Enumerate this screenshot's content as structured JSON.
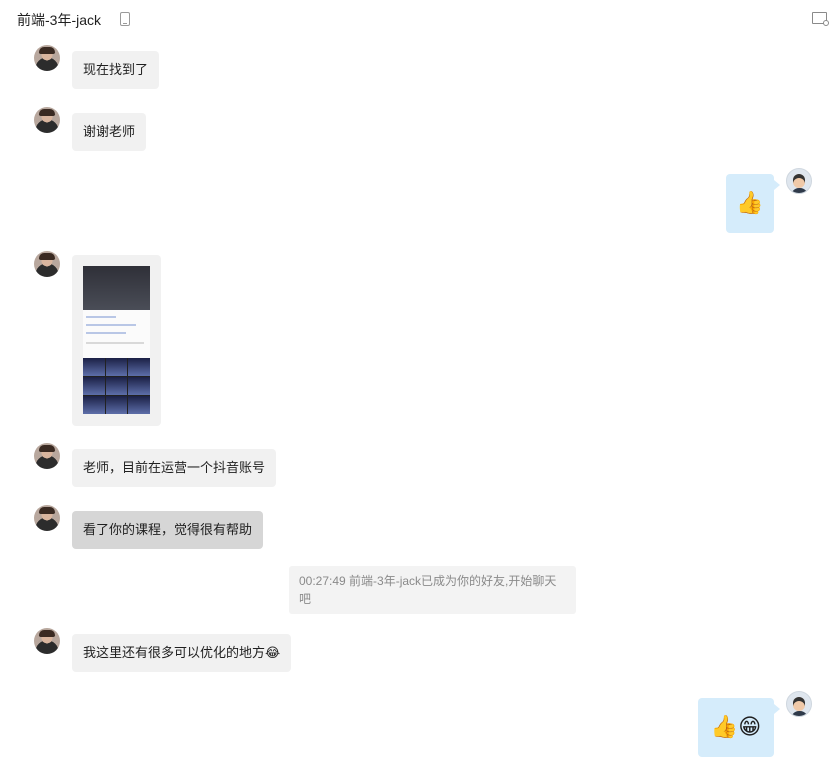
{
  "header": {
    "title": "前端-3年-jack"
  },
  "messages": [
    {
      "text": "现在找到了"
    },
    {
      "text": "谢谢老师"
    },
    {
      "text": "👍"
    },
    {
      "text": "老师，目前在运营一个抖音账号"
    },
    {
      "text": "看了你的课程，觉得很有帮助"
    },
    {
      "text": "我这里还有很多可以优化的地方😂"
    },
    {
      "text": "👍😁"
    }
  ],
  "system": {
    "text": "00:27:49 前端-3年-jack已成为你的好友,开始聊天吧"
  }
}
